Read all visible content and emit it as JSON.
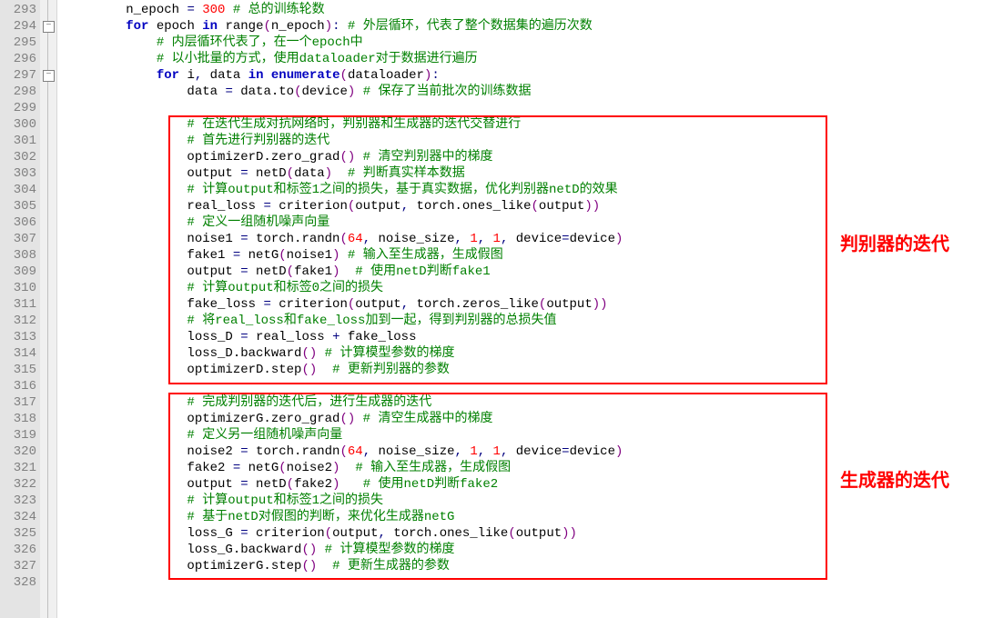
{
  "gutter": {
    "start": 293,
    "end": 328,
    "fold_marks": [
      294,
      297
    ]
  },
  "code_lines": [
    {
      "indent": 2,
      "tokens": [
        [
          "blk",
          "n_epoch "
        ],
        [
          "op",
          "="
        ],
        [
          "blk",
          " "
        ],
        [
          "num",
          "300"
        ],
        [
          "blk",
          " "
        ],
        [
          "cm",
          "# 总的训练轮数"
        ]
      ]
    },
    {
      "indent": 2,
      "tokens": [
        [
          "kwb",
          "for"
        ],
        [
          "blk",
          " epoch "
        ],
        [
          "kwb",
          "in"
        ],
        [
          "blk",
          " range"
        ],
        [
          "par",
          "("
        ],
        [
          "blk",
          "n_epoch"
        ],
        [
          "par",
          ")"
        ],
        [
          "op",
          ":"
        ],
        [
          "blk",
          " "
        ],
        [
          "cm",
          "# 外层循环，代表了整个数据集的遍历次数"
        ]
      ]
    },
    {
      "indent": 3,
      "tokens": [
        [
          "cm",
          "# 内层循环代表了，在一个epoch中"
        ]
      ]
    },
    {
      "indent": 3,
      "tokens": [
        [
          "cm",
          "# 以小批量的方式，使用dataloader对于数据进行遍历"
        ]
      ]
    },
    {
      "indent": 3,
      "tokens": [
        [
          "kwb",
          "for"
        ],
        [
          "blk",
          " i"
        ],
        [
          "op",
          ","
        ],
        [
          "blk",
          " data "
        ],
        [
          "kwb",
          "in"
        ],
        [
          "blk",
          " "
        ],
        [
          "kwb",
          "enumerate"
        ],
        [
          "par",
          "("
        ],
        [
          "blk",
          "dataloader"
        ],
        [
          "par",
          ")"
        ],
        [
          "op",
          ":"
        ]
      ]
    },
    {
      "indent": 4,
      "tokens": [
        [
          "blk",
          "data "
        ],
        [
          "op",
          "="
        ],
        [
          "blk",
          " data.to"
        ],
        [
          "par",
          "("
        ],
        [
          "blk",
          "device"
        ],
        [
          "par",
          ")"
        ],
        [
          "blk",
          " "
        ],
        [
          "cm",
          "# 保存了当前批次的训练数据"
        ]
      ]
    },
    {
      "indent": 0,
      "tokens": [
        [
          "blk",
          ""
        ]
      ]
    },
    {
      "indent": 4,
      "tokens": [
        [
          "cm",
          "# 在迭代生成对抗网络时，判别器和生成器的迭代交替进行"
        ]
      ]
    },
    {
      "indent": 4,
      "tokens": [
        [
          "cm",
          "# 首先进行判别器的迭代"
        ]
      ]
    },
    {
      "indent": 4,
      "tokens": [
        [
          "blk",
          "optimizerD.zero_grad"
        ],
        [
          "par",
          "()"
        ],
        [
          "blk",
          " "
        ],
        [
          "cm",
          "# 清空判别器中的梯度"
        ]
      ]
    },
    {
      "indent": 4,
      "tokens": [
        [
          "blk",
          "output "
        ],
        [
          "op",
          "="
        ],
        [
          "blk",
          " netD"
        ],
        [
          "par",
          "("
        ],
        [
          "blk",
          "data"
        ],
        [
          "par",
          ")"
        ],
        [
          "blk",
          "  "
        ],
        [
          "cm",
          "# 判断真实样本数据"
        ]
      ]
    },
    {
      "indent": 4,
      "tokens": [
        [
          "cm",
          "# 计算output和标签1之间的损失，基于真实数据，优化判别器netD的效果"
        ]
      ]
    },
    {
      "indent": 4,
      "tokens": [
        [
          "blk",
          "real_loss "
        ],
        [
          "op",
          "="
        ],
        [
          "blk",
          " criterion"
        ],
        [
          "par",
          "("
        ],
        [
          "blk",
          "output"
        ],
        [
          "op",
          ","
        ],
        [
          "blk",
          " torch.ones_like"
        ],
        [
          "par",
          "("
        ],
        [
          "blk",
          "output"
        ],
        [
          "par",
          "))"
        ]
      ]
    },
    {
      "indent": 4,
      "tokens": [
        [
          "cm",
          "# 定义一组随机噪声向量"
        ]
      ]
    },
    {
      "indent": 4,
      "tokens": [
        [
          "blk",
          "noise1 "
        ],
        [
          "op",
          "="
        ],
        [
          "blk",
          " torch.randn"
        ],
        [
          "par",
          "("
        ],
        [
          "num",
          "64"
        ],
        [
          "op",
          ","
        ],
        [
          "blk",
          " noise_size"
        ],
        [
          "op",
          ","
        ],
        [
          "blk",
          " "
        ],
        [
          "num",
          "1"
        ],
        [
          "op",
          ","
        ],
        [
          "blk",
          " "
        ],
        [
          "num",
          "1"
        ],
        [
          "op",
          ","
        ],
        [
          "blk",
          " device"
        ],
        [
          "op",
          "="
        ],
        [
          "blk",
          "device"
        ],
        [
          "par",
          ")"
        ]
      ]
    },
    {
      "indent": 4,
      "tokens": [
        [
          "blk",
          "fake1 "
        ],
        [
          "op",
          "="
        ],
        [
          "blk",
          " netG"
        ],
        [
          "par",
          "("
        ],
        [
          "blk",
          "noise1"
        ],
        [
          "par",
          ")"
        ],
        [
          "blk",
          " "
        ],
        [
          "cm",
          "# 输入至生成器，生成假图"
        ]
      ]
    },
    {
      "indent": 4,
      "tokens": [
        [
          "blk",
          "output "
        ],
        [
          "op",
          "="
        ],
        [
          "blk",
          " netD"
        ],
        [
          "par",
          "("
        ],
        [
          "blk",
          "fake1"
        ],
        [
          "par",
          ")"
        ],
        [
          "blk",
          "  "
        ],
        [
          "cm",
          "# 使用netD判断fake1"
        ]
      ]
    },
    {
      "indent": 4,
      "tokens": [
        [
          "cm",
          "# 计算output和标签0之间的损失"
        ]
      ]
    },
    {
      "indent": 4,
      "tokens": [
        [
          "blk",
          "fake_loss "
        ],
        [
          "op",
          "="
        ],
        [
          "blk",
          " criterion"
        ],
        [
          "par",
          "("
        ],
        [
          "blk",
          "output"
        ],
        [
          "op",
          ","
        ],
        [
          "blk",
          " torch.zeros_like"
        ],
        [
          "par",
          "("
        ],
        [
          "blk",
          "output"
        ],
        [
          "par",
          "))"
        ]
      ]
    },
    {
      "indent": 4,
      "tokens": [
        [
          "cm",
          "# 将real_loss和fake_loss加到一起，得到判别器的总损失值"
        ]
      ]
    },
    {
      "indent": 4,
      "tokens": [
        [
          "blk",
          "loss_D "
        ],
        [
          "op",
          "="
        ],
        [
          "blk",
          " real_loss "
        ],
        [
          "op",
          "+"
        ],
        [
          "blk",
          " fake_loss"
        ]
      ]
    },
    {
      "indent": 4,
      "tokens": [
        [
          "blk",
          "loss_D.backward"
        ],
        [
          "par",
          "()"
        ],
        [
          "blk",
          " "
        ],
        [
          "cm",
          "# 计算模型参数的梯度"
        ]
      ]
    },
    {
      "indent": 4,
      "tokens": [
        [
          "blk",
          "optimizerD.step"
        ],
        [
          "par",
          "()"
        ],
        [
          "blk",
          "  "
        ],
        [
          "cm",
          "# 更新判别器的参数"
        ]
      ]
    },
    {
      "indent": 0,
      "tokens": [
        [
          "blk",
          ""
        ]
      ]
    },
    {
      "indent": 4,
      "tokens": [
        [
          "cm",
          "# 完成判别器的迭代后，进行生成器的迭代"
        ]
      ]
    },
    {
      "indent": 4,
      "tokens": [
        [
          "blk",
          "optimizerG.zero_grad"
        ],
        [
          "par",
          "()"
        ],
        [
          "blk",
          " "
        ],
        [
          "cm",
          "# 清空生成器中的梯度"
        ]
      ]
    },
    {
      "indent": 4,
      "tokens": [
        [
          "cm",
          "# 定义另一组随机噪声向量"
        ]
      ]
    },
    {
      "indent": 4,
      "tokens": [
        [
          "blk",
          "noise2 "
        ],
        [
          "op",
          "="
        ],
        [
          "blk",
          " torch.randn"
        ],
        [
          "par",
          "("
        ],
        [
          "num",
          "64"
        ],
        [
          "op",
          ","
        ],
        [
          "blk",
          " noise_size"
        ],
        [
          "op",
          ","
        ],
        [
          "blk",
          " "
        ],
        [
          "num",
          "1"
        ],
        [
          "op",
          ","
        ],
        [
          "blk",
          " "
        ],
        [
          "num",
          "1"
        ],
        [
          "op",
          ","
        ],
        [
          "blk",
          " device"
        ],
        [
          "op",
          "="
        ],
        [
          "blk",
          "device"
        ],
        [
          "par",
          ")"
        ]
      ]
    },
    {
      "indent": 4,
      "tokens": [
        [
          "blk",
          "fake2 "
        ],
        [
          "op",
          "="
        ],
        [
          "blk",
          " netG"
        ],
        [
          "par",
          "("
        ],
        [
          "blk",
          "noise2"
        ],
        [
          "par",
          ")"
        ],
        [
          "blk",
          "  "
        ],
        [
          "cm",
          "# 输入至生成器，生成假图"
        ]
      ]
    },
    {
      "indent": 4,
      "tokens": [
        [
          "blk",
          "output "
        ],
        [
          "op",
          "="
        ],
        [
          "blk",
          " netD"
        ],
        [
          "par",
          "("
        ],
        [
          "blk",
          "fake2"
        ],
        [
          "par",
          ")"
        ],
        [
          "blk",
          "   "
        ],
        [
          "cm",
          "# 使用netD判断fake2"
        ]
      ]
    },
    {
      "indent": 4,
      "tokens": [
        [
          "cm",
          "# 计算output和标签1之间的损失"
        ]
      ]
    },
    {
      "indent": 4,
      "tokens": [
        [
          "cm",
          "# 基于netD对假图的判断，来优化生成器netG"
        ]
      ]
    },
    {
      "indent": 4,
      "tokens": [
        [
          "blk",
          "loss_G "
        ],
        [
          "op",
          "="
        ],
        [
          "blk",
          " criterion"
        ],
        [
          "par",
          "("
        ],
        [
          "blk",
          "output"
        ],
        [
          "op",
          ","
        ],
        [
          "blk",
          " torch.ones_like"
        ],
        [
          "par",
          "("
        ],
        [
          "blk",
          "output"
        ],
        [
          "par",
          "))"
        ]
      ]
    },
    {
      "indent": 4,
      "tokens": [
        [
          "blk",
          "loss_G.backward"
        ],
        [
          "par",
          "()"
        ],
        [
          "blk",
          " "
        ],
        [
          "cm",
          "# 计算模型参数的梯度"
        ]
      ]
    },
    {
      "indent": 4,
      "tokens": [
        [
          "blk",
          "optimizerG.step"
        ],
        [
          "par",
          "()"
        ],
        [
          "blk",
          "  "
        ],
        [
          "cm",
          "# 更新生成器的参数"
        ]
      ]
    },
    {
      "indent": 0,
      "tokens": [
        [
          "blk",
          ""
        ]
      ]
    }
  ],
  "annotations": {
    "box1": {
      "label": "判别器的迭代"
    },
    "box2": {
      "label": "生成器的迭代"
    }
  }
}
